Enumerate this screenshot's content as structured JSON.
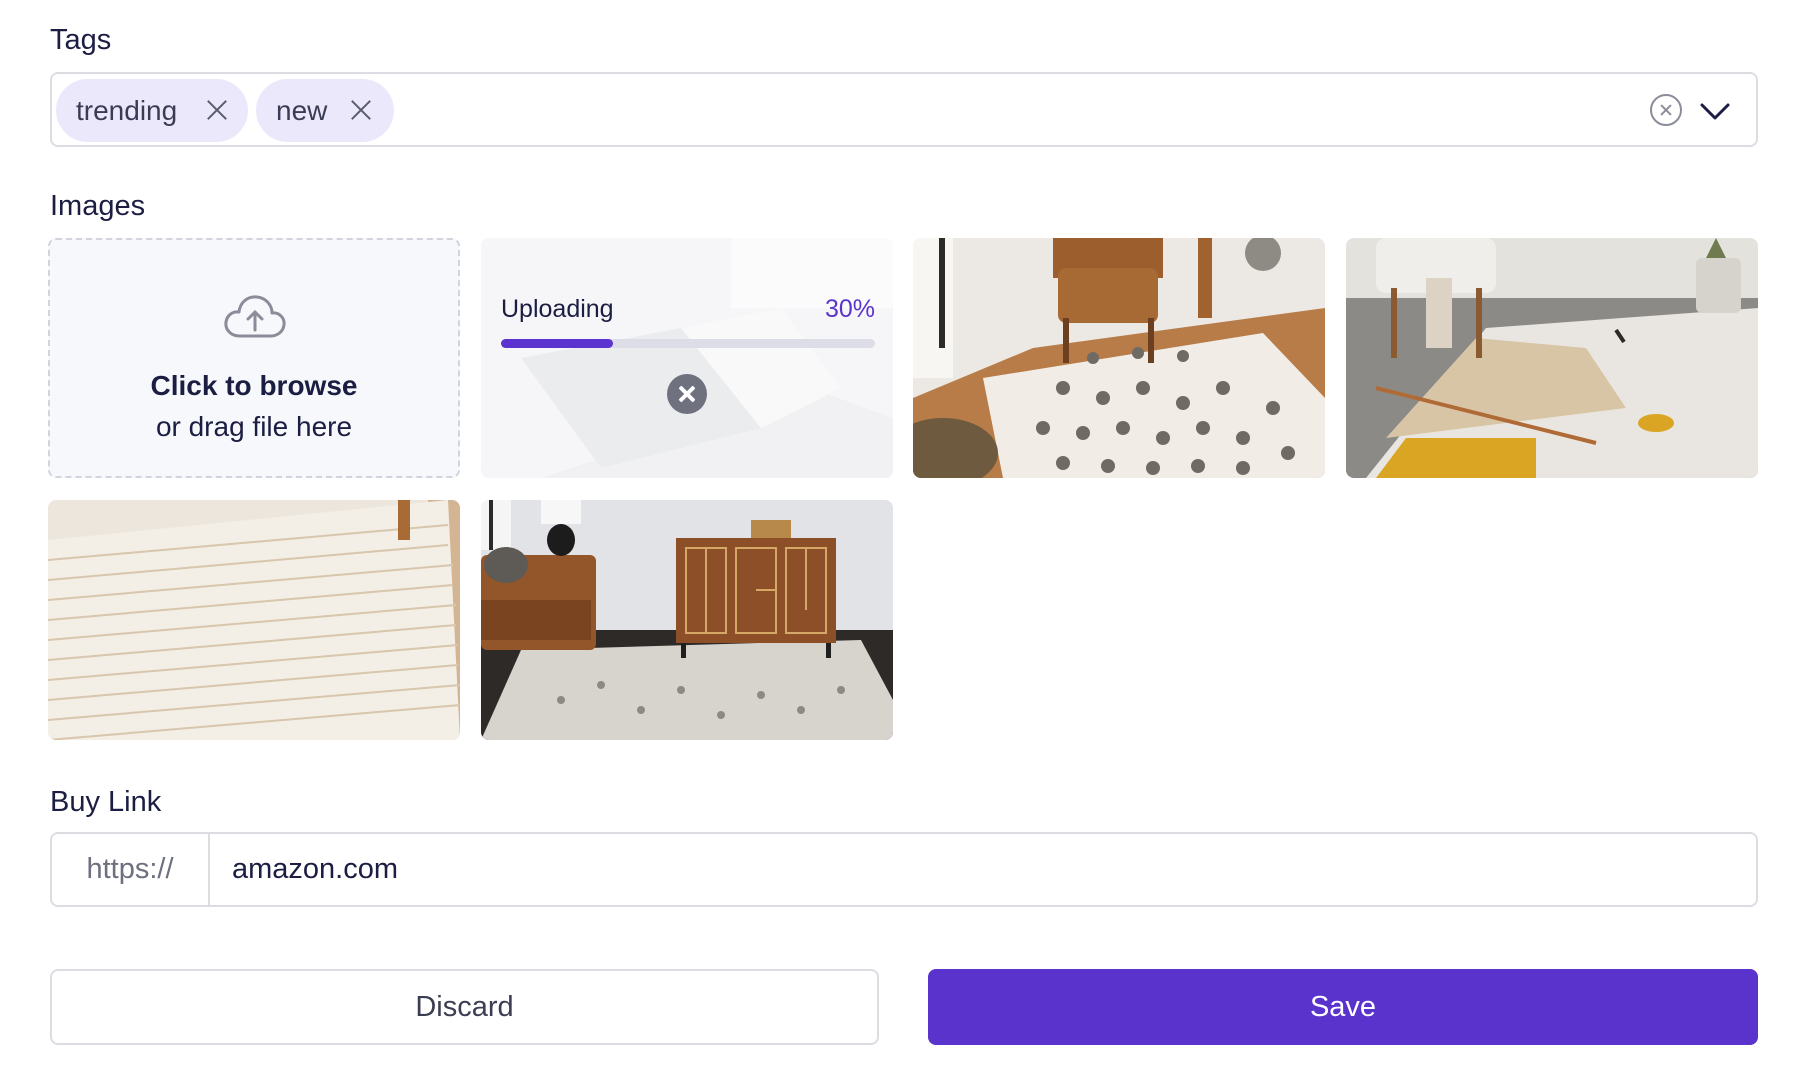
{
  "tags": {
    "label": "Tags",
    "chips": [
      {
        "label": "trending"
      },
      {
        "label": "new"
      }
    ],
    "clear_icon": "close-circle-icon",
    "dropdown_icon": "chevron-down-icon"
  },
  "images": {
    "label": "Images",
    "dropzone": {
      "icon": "cloud-upload-icon",
      "title": "Click to browse",
      "subtitle": "or drag file here"
    },
    "uploading": {
      "label": "Uploading",
      "percent_text": "30%",
      "progress": 0.3,
      "cancel_icon": "close-icon"
    }
  },
  "buy_link": {
    "label": "Buy Link",
    "prefix": "https://",
    "value": "amazon.com"
  },
  "actions": {
    "discard_label": "Discard",
    "save_label": "Save"
  },
  "colors": {
    "accent": "#5a33cc",
    "chip_bg": "#ece8fb",
    "border": "#dcdde3"
  }
}
